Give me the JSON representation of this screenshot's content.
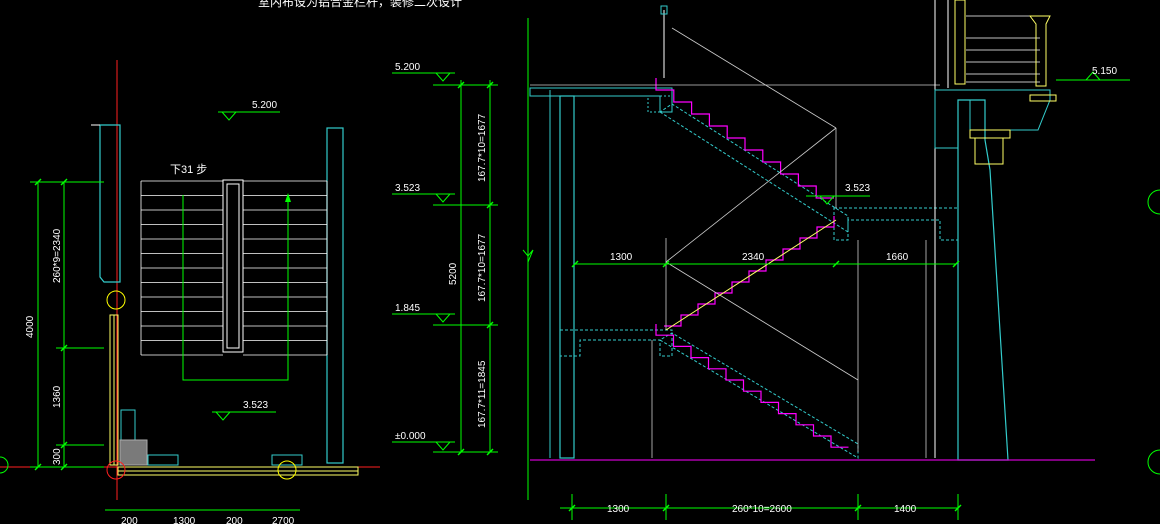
{
  "colors": {
    "background": "#000000",
    "dimension": "#00ff00",
    "wall": "#33cccc",
    "tread": "#ff00ff",
    "centerline": "#ff0000",
    "text": "#ffffff",
    "rail": "#ffff66",
    "ground": "#cc00cc"
  },
  "header": {
    "note": "室内布设为铝合金栏杆，装修二次设计"
  },
  "plan": {
    "elev_top": "5.200",
    "elev_landing": "3.523",
    "stair_label": "下31 步",
    "dim_vertical": [
      "4000",
      "260*9=2340",
      "1360",
      "300"
    ],
    "dim_bottom": [
      "200",
      "1300",
      "200",
      "2700"
    ]
  },
  "elevation_axis": {
    "levels": [
      "5.200",
      "3.523",
      "1.845",
      "±0.000"
    ],
    "dims": [
      "167.7*10=1677",
      "167.7*10=1677",
      "167.7*11=1845"
    ],
    "total": "5200"
  },
  "section": {
    "elev_landing": "3.523",
    "elev_right": "5.150",
    "mid_dims": [
      "1300",
      "2340",
      "1660"
    ],
    "bottom_dims": [
      "1300",
      "260*10=2600",
      "1400"
    ]
  }
}
